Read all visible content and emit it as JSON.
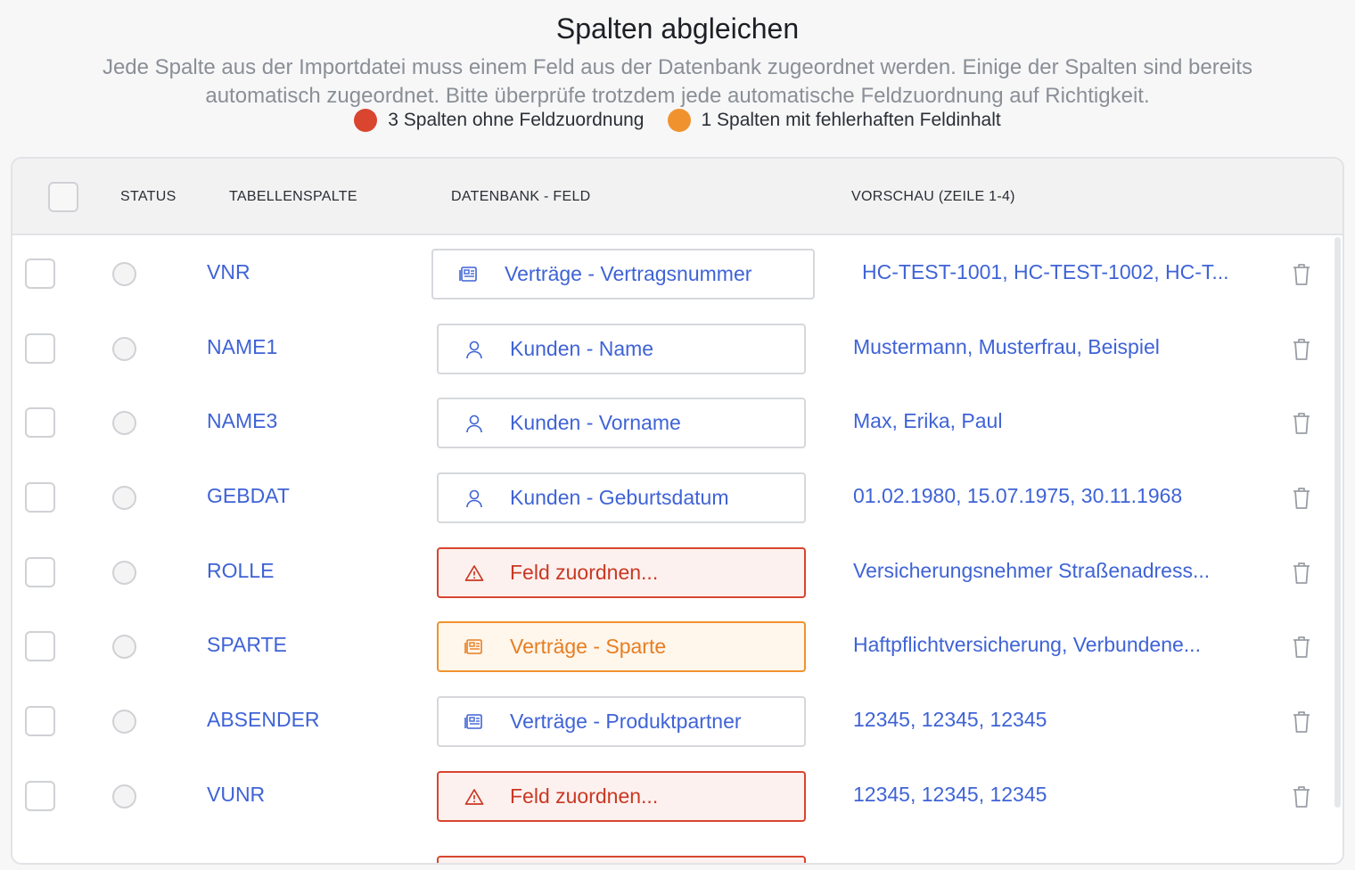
{
  "header": {
    "title": "Spalten abgleichen",
    "subtitle_line1": "Jede Spalte aus der Importdatei muss einem Feld aus der Datenbank zugeordnet werden. Einige der Spalten sind bereits",
    "subtitle_line2": "automatisch zugeordnet. Bitte überprüfe trotzdem jede automatische Feldzuordnung auf Richtigkeit."
  },
  "legend": {
    "error_text": "3 Spalten ohne Feldzuordnung",
    "warn_text": "1 Spalten mit fehlerhaften Feldinhalt",
    "error_color": "#d9452f",
    "warn_color": "#f0932e"
  },
  "table": {
    "columns": {
      "status": "STATUS",
      "tabellenspalte": "TABELLENSPALTE",
      "datenbank_feld": "DATENBANK - FELD",
      "vorschau": "VORSCHAU (ZEILE 1-4)"
    },
    "rows": [
      {
        "name": "VNR",
        "field": "Verträge - Vertragsnummer",
        "icon": "document-icon",
        "state": "ok",
        "preview": "HC-TEST-1001, HC-TEST-1002, HC-T..."
      },
      {
        "name": "NAME1",
        "field": "Kunden - Name",
        "icon": "user-icon",
        "state": "ok",
        "preview": "Mustermann, Musterfrau, Beispiel"
      },
      {
        "name": "NAME3",
        "field": "Kunden - Vorname",
        "icon": "user-icon",
        "state": "ok",
        "preview": "Max, Erika, Paul"
      },
      {
        "name": "GEBDAT",
        "field": "Kunden - Geburtsdatum",
        "icon": "user-icon",
        "state": "ok",
        "preview": "01.02.1980, 15.07.1975, 30.11.1968"
      },
      {
        "name": "ROLLE",
        "field": "Feld zuordnen...",
        "icon": "warning-icon",
        "state": "error",
        "preview": "Versicherungsnehmer Straßenadress..."
      },
      {
        "name": "SPARTE",
        "field": "Verträge - Sparte",
        "icon": "document-icon",
        "state": "warn",
        "preview": "Haftpflichtversicherung, Verbundene..."
      },
      {
        "name": "ABSENDER",
        "field": "Verträge - Produktpartner",
        "icon": "document-icon",
        "state": "ok",
        "preview": "12345, 12345, 12345"
      },
      {
        "name": "VUNR",
        "field": "Feld zuordnen...",
        "icon": "warning-icon",
        "state": "error",
        "preview": "12345, 12345, 12345"
      }
    ]
  }
}
